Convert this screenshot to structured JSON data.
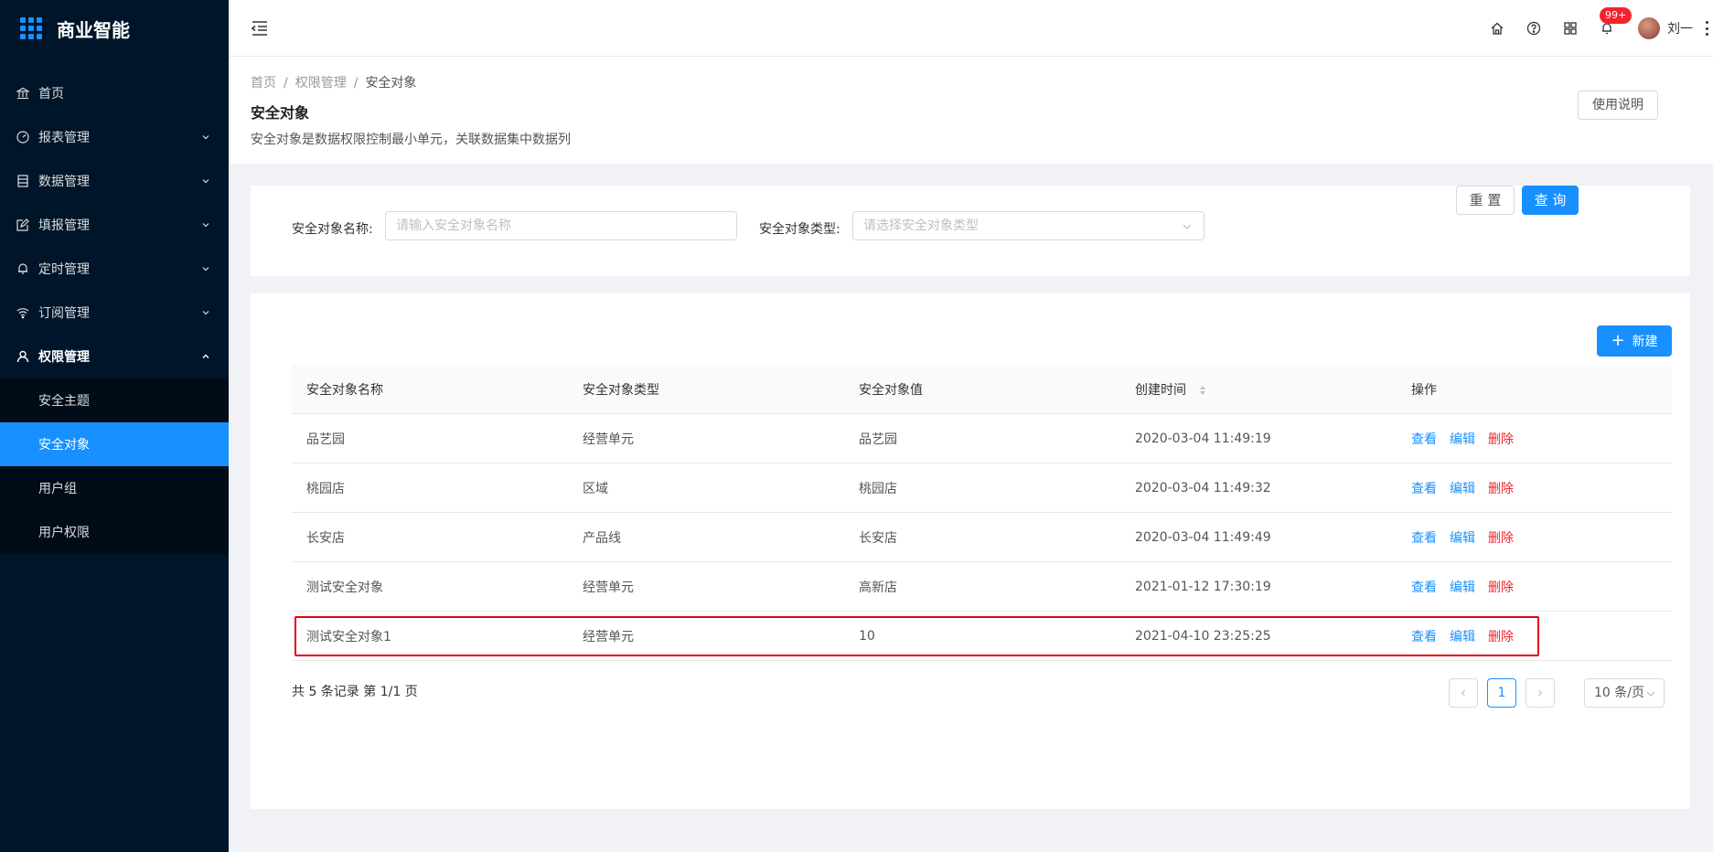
{
  "app": {
    "title": "商业智能"
  },
  "sidebar": {
    "items": [
      {
        "label": "首页",
        "icon": "bank-icon"
      },
      {
        "label": "报表管理",
        "icon": "dashboard-icon"
      },
      {
        "label": "数据管理",
        "icon": "database-icon"
      },
      {
        "label": "填报管理",
        "icon": "form-edit-icon"
      },
      {
        "label": "定时管理",
        "icon": "bell-icon"
      },
      {
        "label": "订阅管理",
        "icon": "wifi-icon"
      },
      {
        "label": "权限管理",
        "icon": "user-icon"
      }
    ],
    "submenu": [
      "安全主题",
      "安全对象",
      "用户组",
      "用户权限"
    ],
    "active_submenu": "安全对象"
  },
  "header": {
    "badge": "99+",
    "user_name": "刘一",
    "icons": [
      "home-icon",
      "question-icon",
      "appstore-icon",
      "bell-icon",
      "more-icon"
    ]
  },
  "page": {
    "breadcrumb": [
      "首页",
      "权限管理",
      "安全对象"
    ],
    "title": "安全对象",
    "description": "安全对象是数据权限控制最小单元，关联数据集中数据列",
    "help_button": "使用说明"
  },
  "search": {
    "name_label": "安全对象名称:",
    "name_placeholder": "请输入安全对象名称",
    "type_label": "安全对象类型:",
    "type_placeholder": "请选择安全对象类型",
    "reset_label": "重 置",
    "query_label": "查 询"
  },
  "table": {
    "new_button": "新建",
    "columns": [
      "安全对象名称",
      "安全对象类型",
      "安全对象值",
      "创建时间",
      "操作"
    ],
    "actions": {
      "view": "查看",
      "edit": "编辑",
      "delete": "删除"
    },
    "rows": [
      {
        "name": "品艺园",
        "type": "经营单元",
        "value": "品艺园",
        "created": "2020-03-04 11:49:19"
      },
      {
        "name": "桃园店",
        "type": "区域",
        "value": "桃园店",
        "created": "2020-03-04 11:49:32"
      },
      {
        "name": "长安店",
        "type": "产品线",
        "value": "长安店",
        "created": "2020-03-04 11:49:49"
      },
      {
        "name": "测试安全对象",
        "type": "经营单元",
        "value": "高新店",
        "created": "2021-01-12 17:30:19"
      },
      {
        "name": "测试安全对象1",
        "type": "经营单元",
        "value": "10",
        "created": "2021-04-10 23:25:25"
      }
    ],
    "accent_color": "#1890ff",
    "highlight_color": "#e60012"
  },
  "pagination": {
    "total_text": "共 5 条记录 第 1/1 页",
    "current_page": "1",
    "page_size": "10 条/页"
  }
}
